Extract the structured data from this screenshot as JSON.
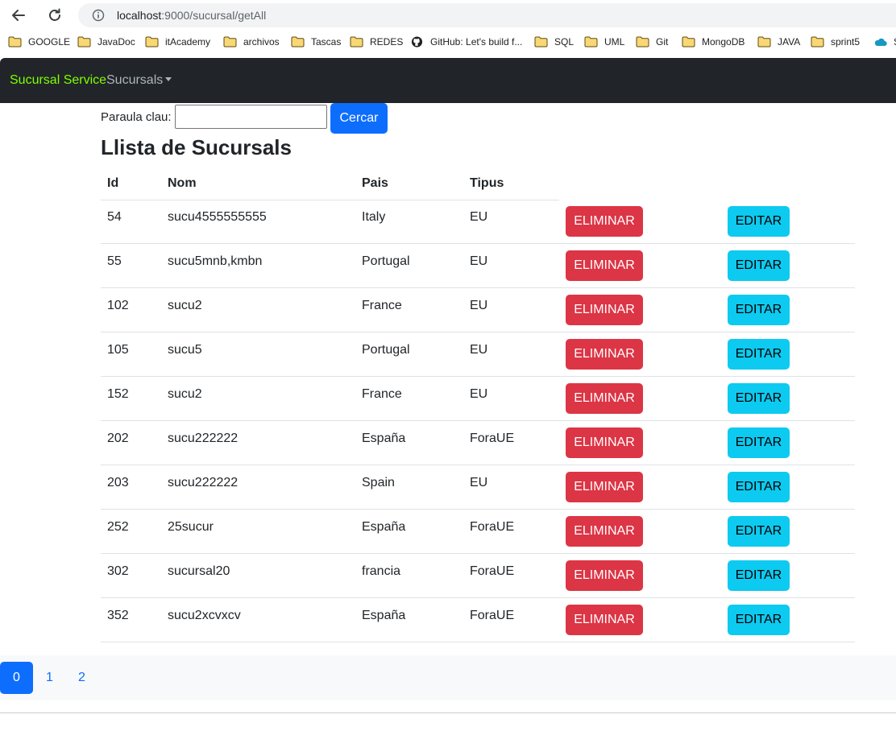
{
  "browser": {
    "url_host": "localhost",
    "url_rest": ":9000/sucursal/getAll",
    "bookmarks": [
      {
        "label": "GOOGLE",
        "icon": "folder-icon"
      },
      {
        "label": "JavaDoc",
        "icon": "folder-icon"
      },
      {
        "label": "itAcademy",
        "icon": "folder-icon"
      },
      {
        "label": "archivos",
        "icon": "folder-icon"
      },
      {
        "label": "Tascas",
        "icon": "folder-icon"
      },
      {
        "label": "REDES",
        "icon": "folder-icon"
      },
      {
        "label": "GitHub: Let's build f...",
        "icon": "github-icon"
      },
      {
        "label": "SQL",
        "icon": "folder-icon"
      },
      {
        "label": "UML",
        "icon": "folder-icon"
      },
      {
        "label": "Git",
        "icon": "folder-icon"
      },
      {
        "label": "MongoDB",
        "icon": "folder-icon"
      },
      {
        "label": "JAVA",
        "icon": "folder-icon"
      },
      {
        "label": "sprint5",
        "icon": "folder-icon"
      },
      {
        "label": "S",
        "icon": "cloud-icon"
      }
    ]
  },
  "navbar": {
    "brand": "Sucursal Service",
    "menu": "Sucursals"
  },
  "search": {
    "label": "Paraula clau:",
    "value": "",
    "button": "Cercar"
  },
  "title": "Llista de Sucursals",
  "table": {
    "headers": [
      "Id",
      "Nom",
      "Pais",
      "Tipus"
    ],
    "rows": [
      {
        "id": "54",
        "nom": "sucu4555555555",
        "pais": "Italy",
        "tipus": "EU"
      },
      {
        "id": "55",
        "nom": "sucu5mnb,kmbn",
        "pais": "Portugal",
        "tipus": "EU"
      },
      {
        "id": "102",
        "nom": "sucu2",
        "pais": "France",
        "tipus": "EU"
      },
      {
        "id": "105",
        "nom": "sucu5",
        "pais": "Portugal",
        "tipus": "EU"
      },
      {
        "id": "152",
        "nom": "sucu2",
        "pais": "France",
        "tipus": "EU"
      },
      {
        "id": "202",
        "nom": "sucu222222",
        "pais": "España",
        "tipus": "ForaUE"
      },
      {
        "id": "203",
        "nom": "sucu222222",
        "pais": "Spain",
        "tipus": "EU"
      },
      {
        "id": "252",
        "nom": "25sucur",
        "pais": "España",
        "tipus": "ForaUE"
      },
      {
        "id": "302",
        "nom": "sucursal20",
        "pais": "francia",
        "tipus": "ForaUE"
      },
      {
        "id": "352",
        "nom": "sucu2xcvxcv",
        "pais": "España",
        "tipus": "ForaUE"
      }
    ],
    "delete_label": "ELIMINAR",
    "edit_label": "EDITAR"
  },
  "pagination": {
    "pages": [
      "0",
      "1",
      "2"
    ],
    "active": "0"
  },
  "colors": {
    "brand": "#7fff00",
    "navbar_bg": "#212529",
    "primary": "#0d6efd",
    "danger": "#dc3545",
    "info": "#0dcaf0"
  }
}
